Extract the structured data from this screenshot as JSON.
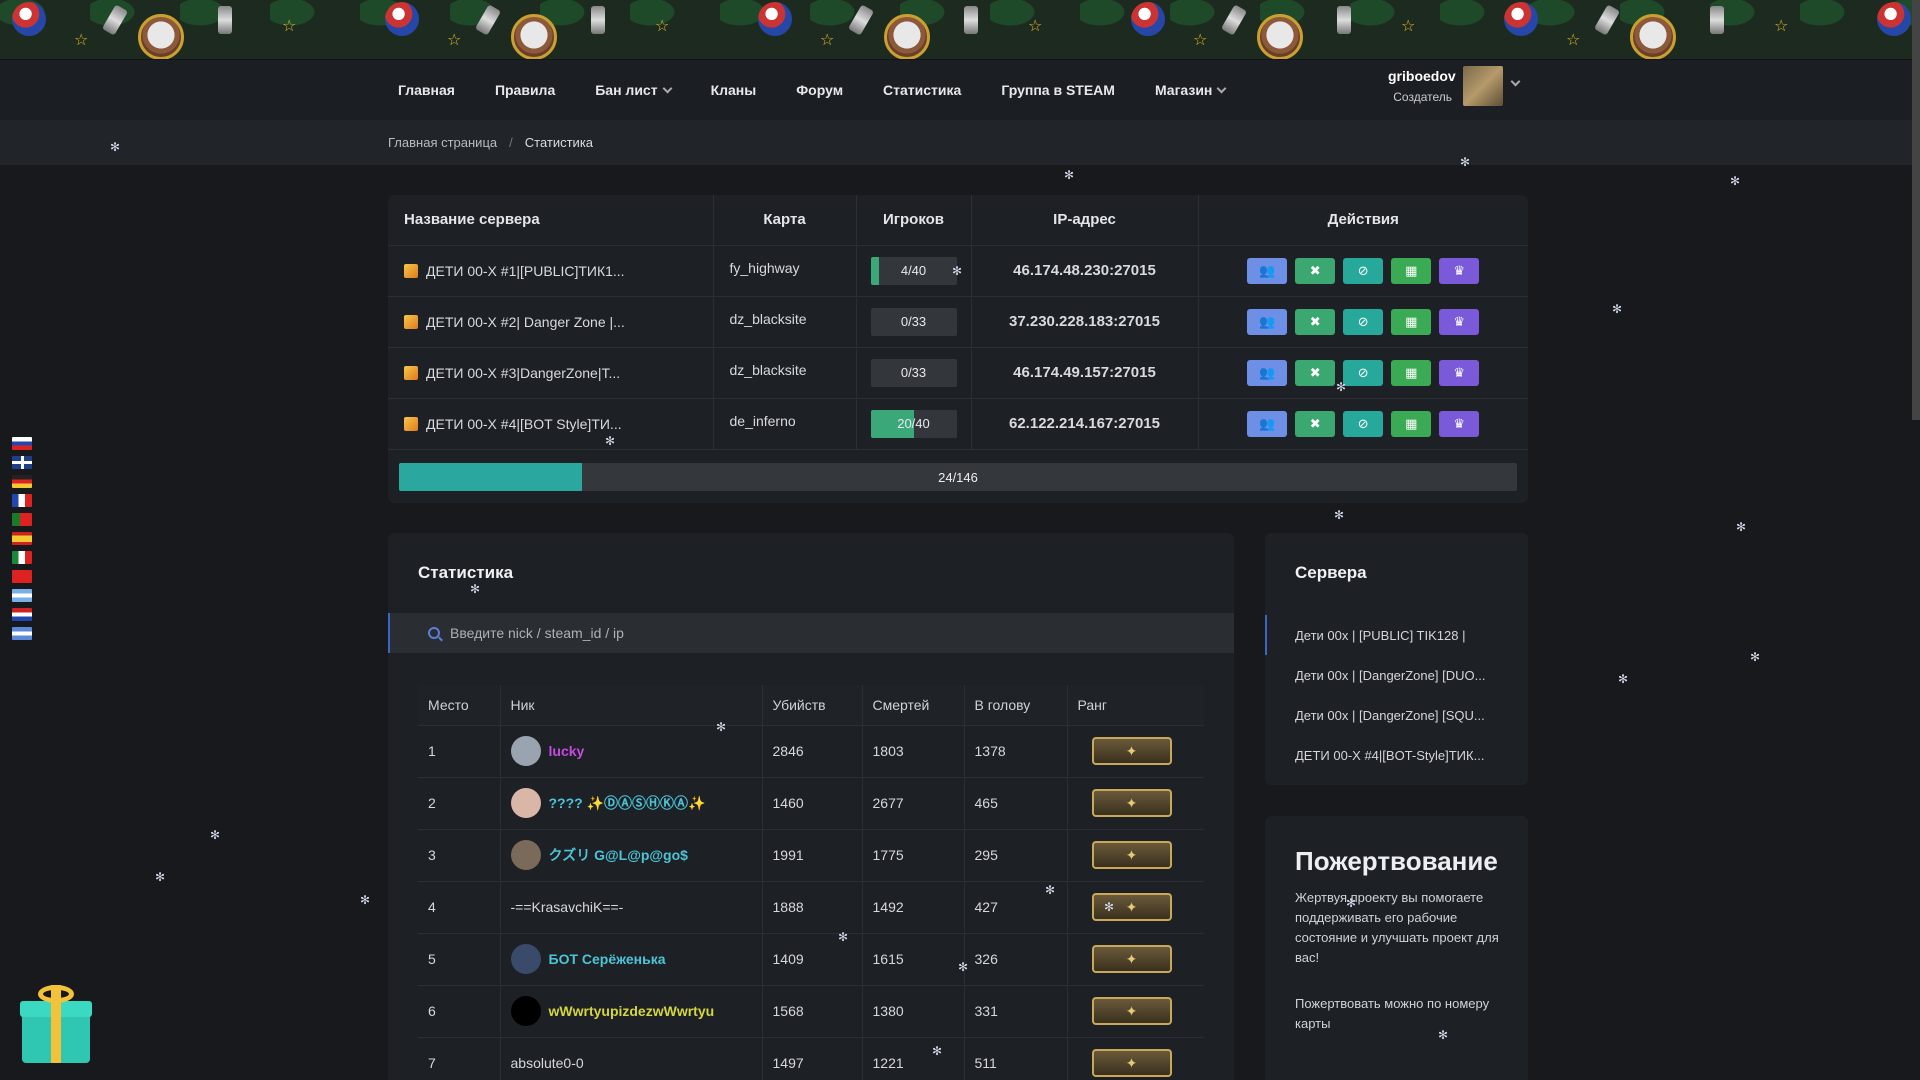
{
  "nav": {
    "links": [
      "Главная",
      "Правила",
      "Бан лист",
      "Кланы",
      "Форум",
      "Статистика",
      "Группа в STEAM",
      "Магазин"
    ],
    "user_name": "griboedov",
    "user_role": "Создатель"
  },
  "breadcrumb": {
    "home": "Главная страница",
    "sep": "/",
    "current": "Статистика"
  },
  "servers": {
    "headers": {
      "name": "Название сервера",
      "map": "Карта",
      "players": "Игроков",
      "ip": "IP-адрес",
      "actions": "Действия"
    },
    "rows": [
      {
        "name": "ДЕТИ 00-Х #1|[PUBLIC]ТИК1...",
        "map": "fy_highway",
        "players": "4/40",
        "fill": 0.1,
        "ip": "46.174.48.230:27015"
      },
      {
        "name": "ДЕТИ 00-Х #2| Danger Zone |...",
        "map": "dz_blacksite",
        "players": "0/33",
        "fill": 0,
        "ip": "37.230.228.183:27015"
      },
      {
        "name": "ДЕТИ 00-Х #3|DangerZone|T...",
        "map": "dz_blacksite",
        "players": "0/33",
        "fill": 0,
        "ip": "46.174.49.157:27015"
      },
      {
        "name": "ДЕТИ 00-Х #4|[BOT Style]ТИ...",
        "map": "de_inferno",
        "players": "20/40",
        "fill": 0.5,
        "ip": "62.122.214.167:27015"
      }
    ],
    "total": "24/146",
    "total_fill": 0.164
  },
  "stats": {
    "title": "Статистика",
    "search_placeholder": "Введите nick / steam_id / ip",
    "headers": {
      "place": "Место",
      "nick": "Ник",
      "kills": "Убийств",
      "deaths": "Смертей",
      "hs": "В голову",
      "rank": "Ранг"
    },
    "rows": [
      {
        "place": "1",
        "nick": "lucky",
        "kills": "2846",
        "deaths": "1803",
        "hs": "1378",
        "color": "#c64be0",
        "avatar": "#9aa4b0"
      },
      {
        "place": "2",
        "nick": "???? ✨ⒹⒶⓈⒽⓀⒶ✨",
        "kills": "1460",
        "deaths": "2677",
        "hs": "465",
        "color": "#4cc4d8",
        "avatar": "#d9b6a8"
      },
      {
        "place": "3",
        "nick": "クズリ G@L@p@go$",
        "kills": "1991",
        "deaths": "1775",
        "hs": "295",
        "color": "#4cc4d8",
        "avatar": "#7a6a5a"
      },
      {
        "place": "4",
        "nick": "-==KrasavchiK==-",
        "kills": "1888",
        "deaths": "1492",
        "hs": "427",
        "color": "#d6d8dc",
        "avatar": ""
      },
      {
        "place": "5",
        "nick": "БОТ Серёженька",
        "kills": "1409",
        "deaths": "1615",
        "hs": "326",
        "color": "#4cc4d8",
        "avatar": "#3a4a6a"
      },
      {
        "place": "6",
        "nick": "wWwrtyupizdezwWwrtyu",
        "kills": "1568",
        "deaths": "1380",
        "hs": "331",
        "color": "#d4d640",
        "avatar": "#000000"
      },
      {
        "place": "7",
        "nick": "absolute0-0",
        "kills": "1497",
        "deaths": "1221",
        "hs": "511",
        "color": "#d6d8dc",
        "avatar": ""
      }
    ]
  },
  "sidebar": {
    "title": "Сервера",
    "items": [
      "Дети 00x | [PUBLIC] TIK128 |",
      "Дети 00x | [DangerZone] [DUO...",
      "Дети 00x | [DangerZone] [SQU...",
      "ДЕТИ 00-Х #4|[BOT-Style]ТИК..."
    ]
  },
  "donate": {
    "title": "Пожертвование",
    "text1": "Жертвуя проекту вы помогаете поддерживать его рабочие состояние и улучшать проект для вас!",
    "text2": "Пожертвовать можно по номеру карты"
  }
}
